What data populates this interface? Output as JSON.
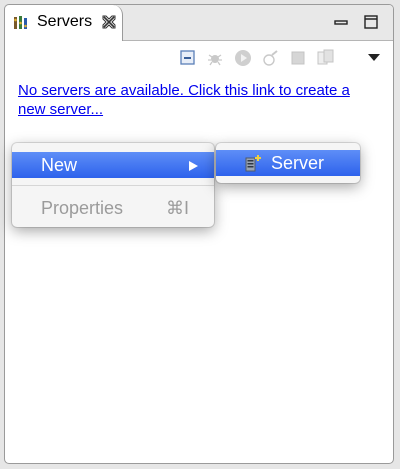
{
  "tab": {
    "label": "Servers"
  },
  "empty_link": "No servers are available. Click this link to create a new server...",
  "context_menu": {
    "items": [
      {
        "label": "New",
        "selected": true,
        "has_submenu": true
      },
      {
        "label": "Properties",
        "shortcut": "⌘I",
        "disabled": true
      }
    ]
  },
  "submenu": {
    "items": [
      {
        "label": "Server",
        "icon": "new-server-icon"
      }
    ]
  },
  "colors": {
    "selection": "#3d6ff0",
    "link": "#0000ee"
  }
}
